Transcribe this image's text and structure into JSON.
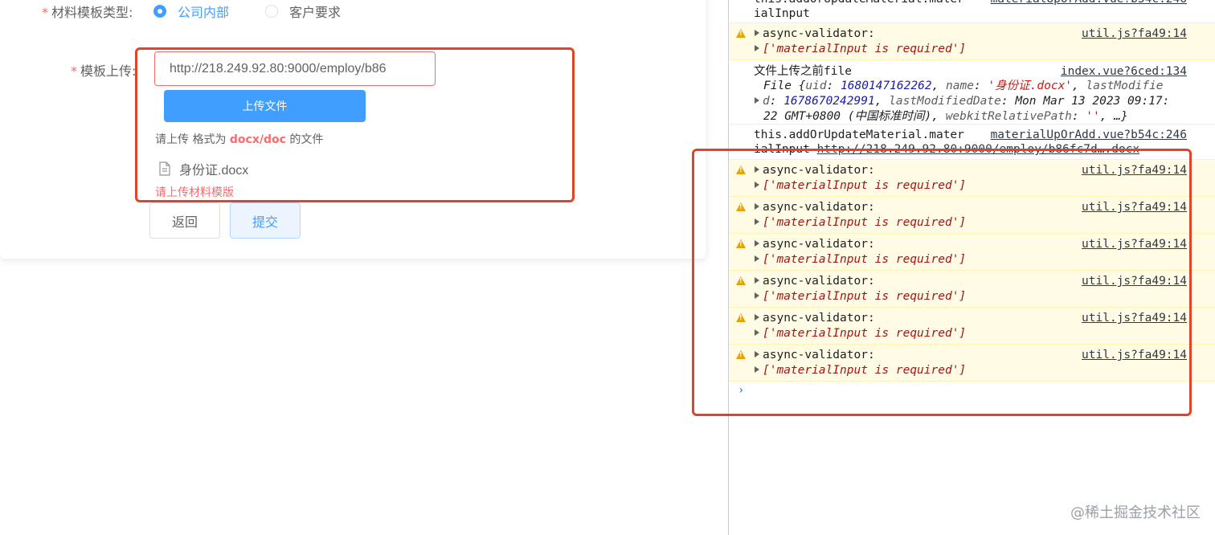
{
  "form": {
    "type_label": "材料模板类型:",
    "required_mark": "*",
    "radio_internal": "公司内部",
    "radio_client": "客户要求",
    "upload_label": "模板上传:",
    "url_value": "http://218.249.92.80:9000/employ/b86",
    "upload_button": "上传文件",
    "tip_prefix": "请上传 格式为",
    "tip_format": "docx/doc",
    "tip_suffix": "的文件",
    "file_name": "身份证.docx",
    "error": "请上传材料模版",
    "back_button": "返回",
    "submit_button": "提交"
  },
  "console": {
    "top_line1": "this.addOrUpdateMaterial.mater",
    "top_src": "materialUpOrAdd.vue?b54c:246",
    "top_line2": "ialInput",
    "warn_label": "async-validator:",
    "warn_src": "util.js?fa49:14",
    "warn_array": "['materialInput is required']",
    "file_log_label": "文件上传之前file",
    "file_log_src": "index.vue?6ced:134",
    "file_obj": {
      "l1_a": "File {",
      "uid_key": "uid",
      "uid_val": "1680147162262",
      "name_key": "name",
      "name_val": "'身份证.docx'",
      "lm_key_a": "lastModifie",
      "lm_key_b": "d",
      "lm_val": "1678670242991",
      "lmd_key": "lastModifiedDate",
      "lmd_val_a": "Mon Mar 13 2023 09:17:",
      "lmd_val_b": "22 GMT+0800 (中国标准时间)",
      "wrp_key": "webkitRelativePath",
      "wrp_val": "''",
      "tail": "…}"
    },
    "upd_line1": "this.addOrUpdateMaterial.mater",
    "upd_src": "materialUpOrAdd.vue?b54c:246",
    "upd_line2a": "ialInput",
    "upd_link": "http://218.249.92.80:9000/employ/b86fc7d….docx",
    "prompt": "›"
  },
  "watermark": "@稀土掘金技术社区"
}
